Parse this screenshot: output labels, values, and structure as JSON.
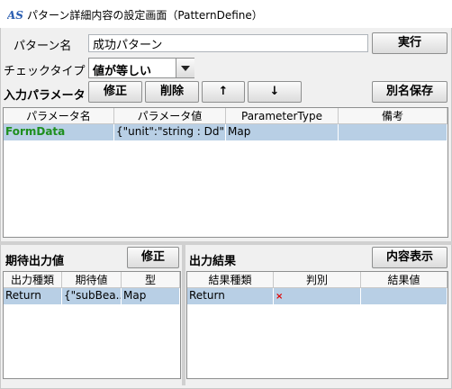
{
  "window": {
    "title": "パターン詳細内容の設定画面（PatternDefine）",
    "icon_text": "AS"
  },
  "pattern_name": {
    "label": "パターン名",
    "value": "成功パターン"
  },
  "run_button": "実行",
  "check_type": {
    "label": "チェックタイプ",
    "selected": "値が等しい"
  },
  "input_params": {
    "label": "入力パラメータ",
    "edit_button": "修正",
    "delete_button": "削除",
    "up_button": "↑",
    "down_button": "↓",
    "save_as_button": "別名保存",
    "columns": [
      "パラメータ名",
      "パラメータ値",
      "ParameterType",
      "備考"
    ],
    "rows": [
      {
        "name": "FormData",
        "value": "{\"unit\":\"string : Dd\",\"...",
        "type": "Map",
        "note": ""
      }
    ]
  },
  "expected_output": {
    "label": "期待出力値",
    "edit_button": "修正",
    "columns": [
      "出力種類",
      "期待値",
      "型"
    ],
    "rows": [
      {
        "kind": "Return",
        "expected": "{\"subBea...",
        "type": "Map"
      }
    ]
  },
  "output_result": {
    "label": "出力結果",
    "show_button": "内容表示",
    "columns": [
      "結果種類",
      "判別",
      "結果値"
    ],
    "rows": [
      {
        "kind": "Return",
        "judge": "×",
        "value": ""
      }
    ]
  }
}
